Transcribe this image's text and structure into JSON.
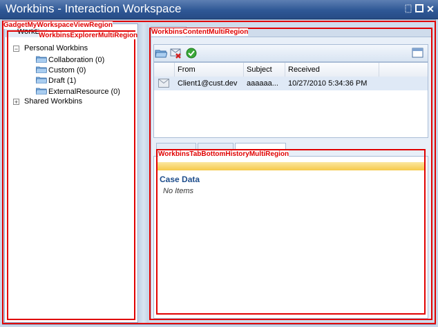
{
  "window": {
    "title": "Workbins - Interaction Workspace"
  },
  "regions": {
    "gadget": "GadgetMyWorkspaceViewRegion",
    "explorer": "WorkbinsExplorerMultiRegion",
    "content": "WorkbinsContentMultiRegion",
    "history": "WorkbinsTabBottomHistoryMultiRegion"
  },
  "left_tab": {
    "label": "WorkE"
  },
  "tree": {
    "personal": {
      "label": "Personal Workbins",
      "expander": "−",
      "children": [
        "Collaboration (0)",
        "Custom (0)",
        "Draft (1)",
        "ExternalResource (0)"
      ]
    },
    "shared": {
      "label": "Shared Workbins",
      "expander": "+"
    }
  },
  "toolbar": {
    "icons": [
      "open-folder-icon",
      "delete-icon",
      "done-icon",
      "view-icon"
    ]
  },
  "grid": {
    "columns": [
      "",
      "From",
      "Subject",
      "Received"
    ],
    "rows": [
      {
        "icon": "mail-icon",
        "from": "Client1@cust.dev",
        "subject": "aaaaaa...",
        "received": "10/27/2010 5:34:36 PM"
      }
    ]
  },
  "bottom": {
    "section_title": "Case Data",
    "empty_text": "No Items"
  }
}
